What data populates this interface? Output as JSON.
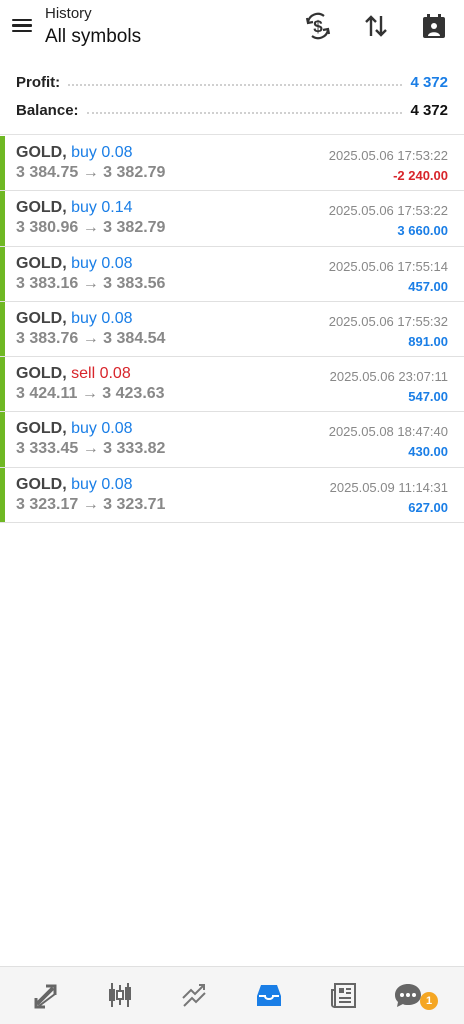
{
  "header": {
    "subtitle": "History",
    "title": "All symbols"
  },
  "summary": {
    "profit_label": "Profit:",
    "profit_value": "4 372",
    "balance_label": "Balance:",
    "balance_value": "4 372"
  },
  "deals": [
    {
      "symbol": "GOLD,",
      "side": "buy 0.08",
      "prices": "3 384.75 → 3 382.79",
      "time": "2025.05.06 17:53:22",
      "profit": "-2 240.00"
    },
    {
      "symbol": "GOLD,",
      "side": "buy 0.14",
      "prices": "3 380.96 → 3 382.79",
      "time": "2025.05.06 17:53:22",
      "profit": "3 660.00"
    },
    {
      "symbol": "GOLD,",
      "side": "buy 0.08",
      "prices": "3 383.16 → 3 383.56",
      "time": "2025.05.06 17:55:14",
      "profit": "457.00"
    },
    {
      "symbol": "GOLD,",
      "side": "buy 0.08",
      "prices": "3 383.76 → 3 384.54",
      "time": "2025.05.06 17:55:32",
      "profit": "891.00"
    },
    {
      "symbol": "GOLD,",
      "side": "sell 0.08",
      "prices": "3 424.11 → 3 423.63",
      "time": "2025.05.06 23:07:11",
      "profit": "547.00"
    },
    {
      "symbol": "GOLD,",
      "side": "buy 0.08",
      "prices": "3 333.45 → 3 333.82",
      "time": "2025.05.08 18:47:40",
      "profit": "430.00"
    },
    {
      "symbol": "GOLD,",
      "side": "buy 0.08",
      "prices": "3 323.17 → 3 323.71",
      "time": "2025.05.09 11:14:31",
      "profit": "627.00"
    }
  ],
  "nav": {
    "chat_badge": "1"
  },
  "colors": {
    "accent_blue": "#1a7ee6",
    "loss_red": "#d8252b",
    "deal_bar_green": "#6fb823",
    "badge_orange": "#f5a623"
  },
  "icons": {
    "header": [
      "menu-icon",
      "currency-exchange-icon",
      "sort-icon",
      "calendar-icon"
    ],
    "nav": [
      "quotes-icon",
      "chart-icon",
      "trade-icon",
      "history-icon",
      "news-icon",
      "chat-icon"
    ]
  }
}
